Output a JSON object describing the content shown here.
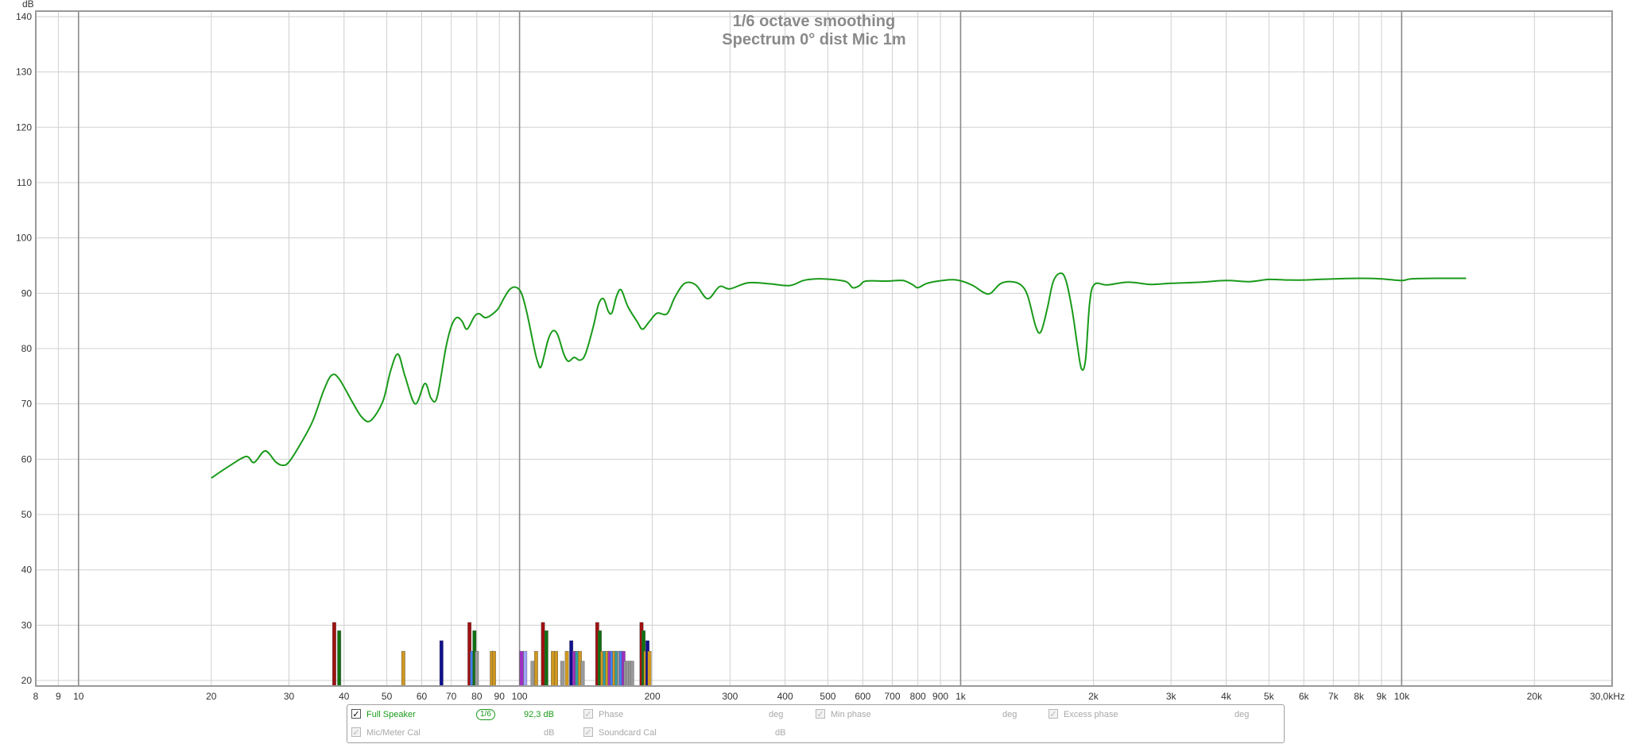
{
  "chart_data": {
    "type": "line",
    "title": "1/6 octave smoothing",
    "subtitle": "Spectrum 0° dist Mic 1m",
    "ylabel": "dB",
    "x_scale": "log",
    "xlim": [
      8,
      30000
    ],
    "ylim": [
      19,
      141
    ],
    "y_ticks": [
      20,
      30,
      40,
      50,
      60,
      70,
      80,
      90,
      100,
      110,
      120,
      130,
      140
    ],
    "x_ticks": [
      {
        "v": 8,
        "label": "8"
      },
      {
        "v": 9,
        "label": "9"
      },
      {
        "v": 10,
        "label": "10"
      },
      {
        "v": 20,
        "label": "20"
      },
      {
        "v": 30,
        "label": "30"
      },
      {
        "v": 40,
        "label": "40"
      },
      {
        "v": 50,
        "label": "50"
      },
      {
        "v": 60,
        "label": "60"
      },
      {
        "v": 70,
        "label": "70"
      },
      {
        "v": 80,
        "label": "80"
      },
      {
        "v": 90,
        "label": "90"
      },
      {
        "v": 100,
        "label": "100"
      },
      {
        "v": 200,
        "label": "200"
      },
      {
        "v": 300,
        "label": "300"
      },
      {
        "v": 400,
        "label": "400"
      },
      {
        "v": 500,
        "label": "500"
      },
      {
        "v": 600,
        "label": "600"
      },
      {
        "v": 700,
        "label": "700"
      },
      {
        "v": 800,
        "label": "800"
      },
      {
        "v": 900,
        "label": "900"
      },
      {
        "v": 1000,
        "label": "1k"
      },
      {
        "v": 2000,
        "label": "2k"
      },
      {
        "v": 3000,
        "label": "3k"
      },
      {
        "v": 4000,
        "label": "4k"
      },
      {
        "v": 5000,
        "label": "5k"
      },
      {
        "v": 6000,
        "label": "6k"
      },
      {
        "v": 7000,
        "label": "7k"
      },
      {
        "v": 8000,
        "label": "8k"
      },
      {
        "v": 9000,
        "label": "9k"
      },
      {
        "v": 10000,
        "label": "10k"
      },
      {
        "v": 20000,
        "label": "20k"
      },
      {
        "v": 30000,
        "label": "30,0kHz"
      }
    ],
    "grid": true,
    "series": [
      {
        "name": "Full Speaker",
        "color": "#1a9a1a",
        "points": [
          [
            20,
            56.6
          ],
          [
            22,
            58.8
          ],
          [
            24,
            60.5
          ],
          [
            25,
            59.4
          ],
          [
            26.5,
            61.5
          ],
          [
            28,
            59.5
          ],
          [
            29,
            58.9
          ],
          [
            30,
            59.5
          ],
          [
            32,
            63
          ],
          [
            34,
            67
          ],
          [
            36,
            72.5
          ],
          [
            37.5,
            75.2
          ],
          [
            39,
            74.5
          ],
          [
            42,
            70
          ],
          [
            44,
            67.5
          ],
          [
            46,
            67
          ],
          [
            49,
            70.5
          ],
          [
            51,
            76
          ],
          [
            53,
            79
          ],
          [
            55,
            75
          ],
          [
            58,
            70
          ],
          [
            61,
            73.7
          ],
          [
            63,
            71
          ],
          [
            65,
            71.2
          ],
          [
            68,
            80
          ],
          [
            70,
            84
          ],
          [
            72,
            85.6
          ],
          [
            74,
            85
          ],
          [
            76,
            83.5
          ],
          [
            79,
            85.8
          ],
          [
            81,
            86.3
          ],
          [
            84,
            85.6
          ],
          [
            89,
            87
          ],
          [
            92,
            89
          ],
          [
            95,
            90.7
          ],
          [
            98,
            91.1
          ],
          [
            101,
            90
          ],
          [
            104,
            86.3
          ],
          [
            108,
            80
          ],
          [
            110,
            77.5
          ],
          [
            112,
            76.8
          ],
          [
            116,
            81.5
          ],
          [
            119,
            83.2
          ],
          [
            122,
            82.5
          ],
          [
            126,
            79
          ],
          [
            129,
            77.7
          ],
          [
            133,
            78.4
          ],
          [
            137,
            77.9
          ],
          [
            141,
            79
          ],
          [
            147,
            84
          ],
          [
            151,
            88
          ],
          [
            155,
            89
          ],
          [
            159,
            86.7
          ],
          [
            162,
            86.5
          ],
          [
            166,
            89.5
          ],
          [
            170,
            90.6
          ],
          [
            176,
            87.6
          ],
          [
            185,
            84.8
          ],
          [
            190,
            83.5
          ],
          [
            197,
            84.9
          ],
          [
            205,
            86.4
          ],
          [
            216,
            86.3
          ],
          [
            225,
            89.3
          ],
          [
            237,
            91.8
          ],
          [
            251,
            91.5
          ],
          [
            267,
            89
          ],
          [
            284,
            91.2
          ],
          [
            300,
            90.8
          ],
          [
            330,
            91.9
          ],
          [
            370,
            91.7
          ],
          [
            410,
            91.4
          ],
          [
            440,
            92.3
          ],
          [
            470,
            92.6
          ],
          [
            510,
            92.5
          ],
          [
            550,
            92.1
          ],
          [
            570,
            91
          ],
          [
            590,
            91.4
          ],
          [
            610,
            92.2
          ],
          [
            680,
            92.2
          ],
          [
            740,
            92.3
          ],
          [
            780,
            91.5
          ],
          [
            800,
            91
          ],
          [
            840,
            91.8
          ],
          [
            910,
            92.3
          ],
          [
            980,
            92.4
          ],
          [
            1060,
            91.5
          ],
          [
            1130,
            90.1
          ],
          [
            1170,
            90
          ],
          [
            1230,
            91.7
          ],
          [
            1300,
            92.1
          ],
          [
            1370,
            91.5
          ],
          [
            1420,
            89.5
          ],
          [
            1480,
            84
          ],
          [
            1520,
            83
          ],
          [
            1570,
            87
          ],
          [
            1620,
            92
          ],
          [
            1680,
            93.6
          ],
          [
            1730,
            92.5
          ],
          [
            1790,
            87
          ],
          [
            1840,
            80.5
          ],
          [
            1880,
            76.3
          ],
          [
            1920,
            78
          ],
          [
            1960,
            88
          ],
          [
            2010,
            91.6
          ],
          [
            2150,
            91.5
          ],
          [
            2400,
            92
          ],
          [
            2700,
            91.6
          ],
          [
            3000,
            91.8
          ],
          [
            3500,
            92
          ],
          [
            4000,
            92.3
          ],
          [
            4500,
            92.1
          ],
          [
            5000,
            92.5
          ],
          [
            5500,
            92.4
          ],
          [
            6000,
            92.4
          ],
          [
            7000,
            92.6
          ],
          [
            8000,
            92.7
          ],
          [
            9000,
            92.6
          ],
          [
            10000,
            92.3
          ],
          [
            10500,
            92.6
          ],
          [
            12000,
            92.7
          ],
          [
            14000,
            92.7
          ]
        ]
      }
    ],
    "histogram": {
      "note": "background",
      "bars": [
        {
          "x": 38.0,
          "h": 30.5,
          "color": "#a01010"
        },
        {
          "x": 39.0,
          "h": 29.0,
          "color": "#107010"
        },
        {
          "x": 54.5,
          "h": 25.3,
          "color": "#d09820"
        },
        {
          "x": 66.5,
          "h": 27.2,
          "color": "#101090"
        },
        {
          "x": 77.0,
          "h": 30.5,
          "color": "#a01010"
        },
        {
          "x": 78.0,
          "h": 25.3,
          "color": "#4080ff"
        },
        {
          "x": 79.0,
          "h": 29.0,
          "color": "#107010"
        },
        {
          "x": 80.0,
          "h": 25.3,
          "color": "#9a9a9a"
        },
        {
          "x": 86.5,
          "h": 25.3,
          "color": "#d09820"
        },
        {
          "x": 87.5,
          "h": 25.3,
          "color": "#d09820"
        },
        {
          "x": 101,
          "h": 25.3,
          "color": "#a030c0"
        },
        {
          "x": 103,
          "h": 25.3,
          "color": "#a0a0ff"
        },
        {
          "x": 107,
          "h": 23.5,
          "color": "#9a9a9a"
        },
        {
          "x": 109,
          "h": 25.3,
          "color": "#d09820"
        },
        {
          "x": 113,
          "h": 30.5,
          "color": "#a01010"
        },
        {
          "x": 115,
          "h": 29.0,
          "color": "#107010"
        },
        {
          "x": 119,
          "h": 25.3,
          "color": "#d09820"
        },
        {
          "x": 121,
          "h": 25.3,
          "color": "#d09820"
        },
        {
          "x": 125,
          "h": 23.5,
          "color": "#9a9a9a"
        },
        {
          "x": 128,
          "h": 25.3,
          "color": "#d09820"
        },
        {
          "x": 131,
          "h": 27.2,
          "color": "#101090"
        },
        {
          "x": 133,
          "h": 25.3,
          "color": "#a030c0"
        },
        {
          "x": 135,
          "h": 25.3,
          "color": "#30a0a0"
        },
        {
          "x": 137,
          "h": 25.3,
          "color": "#d09820"
        },
        {
          "x": 139,
          "h": 23.5,
          "color": "#9a9a9a"
        },
        {
          "x": 150,
          "h": 30.5,
          "color": "#a01010"
        },
        {
          "x": 152,
          "h": 29.0,
          "color": "#107010"
        },
        {
          "x": 154,
          "h": 25.3,
          "color": "#d09820"
        },
        {
          "x": 156,
          "h": 25.3,
          "color": "#30a0a0"
        },
        {
          "x": 158,
          "h": 25.3,
          "color": "#d09820"
        },
        {
          "x": 160,
          "h": 25.3,
          "color": "#a030c0"
        },
        {
          "x": 162,
          "h": 25.3,
          "color": "#4080ff"
        },
        {
          "x": 164,
          "h": 25.3,
          "color": "#d09820"
        },
        {
          "x": 166,
          "h": 25.3,
          "color": "#30a0a0"
        },
        {
          "x": 168,
          "h": 25.3,
          "color": "#9a9a9a"
        },
        {
          "x": 170,
          "h": 25.3,
          "color": "#4080ff"
        },
        {
          "x": 172,
          "h": 25.3,
          "color": "#a030c0"
        },
        {
          "x": 174,
          "h": 23.5,
          "color": "#9a9a9a"
        },
        {
          "x": 176,
          "h": 23.5,
          "color": "#9a9a9a"
        },
        {
          "x": 178,
          "h": 23.5,
          "color": "#9a9a9a"
        },
        {
          "x": 180,
          "h": 23.5,
          "color": "#9a9a9a"
        },
        {
          "x": 189,
          "h": 30.5,
          "color": "#a01010"
        },
        {
          "x": 191,
          "h": 29.0,
          "color": "#107010"
        },
        {
          "x": 193,
          "h": 25.3,
          "color": "#d09820"
        },
        {
          "x": 195,
          "h": 27.2,
          "color": "#101090"
        },
        {
          "x": 197,
          "h": 25.3,
          "color": "#d09820"
        }
      ]
    }
  },
  "legend": {
    "series_name": "Full Speaker",
    "smoothing_badge": "1/6",
    "level_value": "92,3 dB",
    "phase_label": "Phase",
    "phase_unit": "deg",
    "min_phase_label": "Min phase",
    "min_phase_unit": "deg",
    "excess_phase_label": "Excess phase",
    "excess_phase_unit": "deg",
    "mic_cal_label": "Mic/Meter Cal",
    "mic_cal_unit": "dB",
    "soundcard_cal_label": "Soundcard Cal",
    "soundcard_cal_unit": "dB"
  }
}
